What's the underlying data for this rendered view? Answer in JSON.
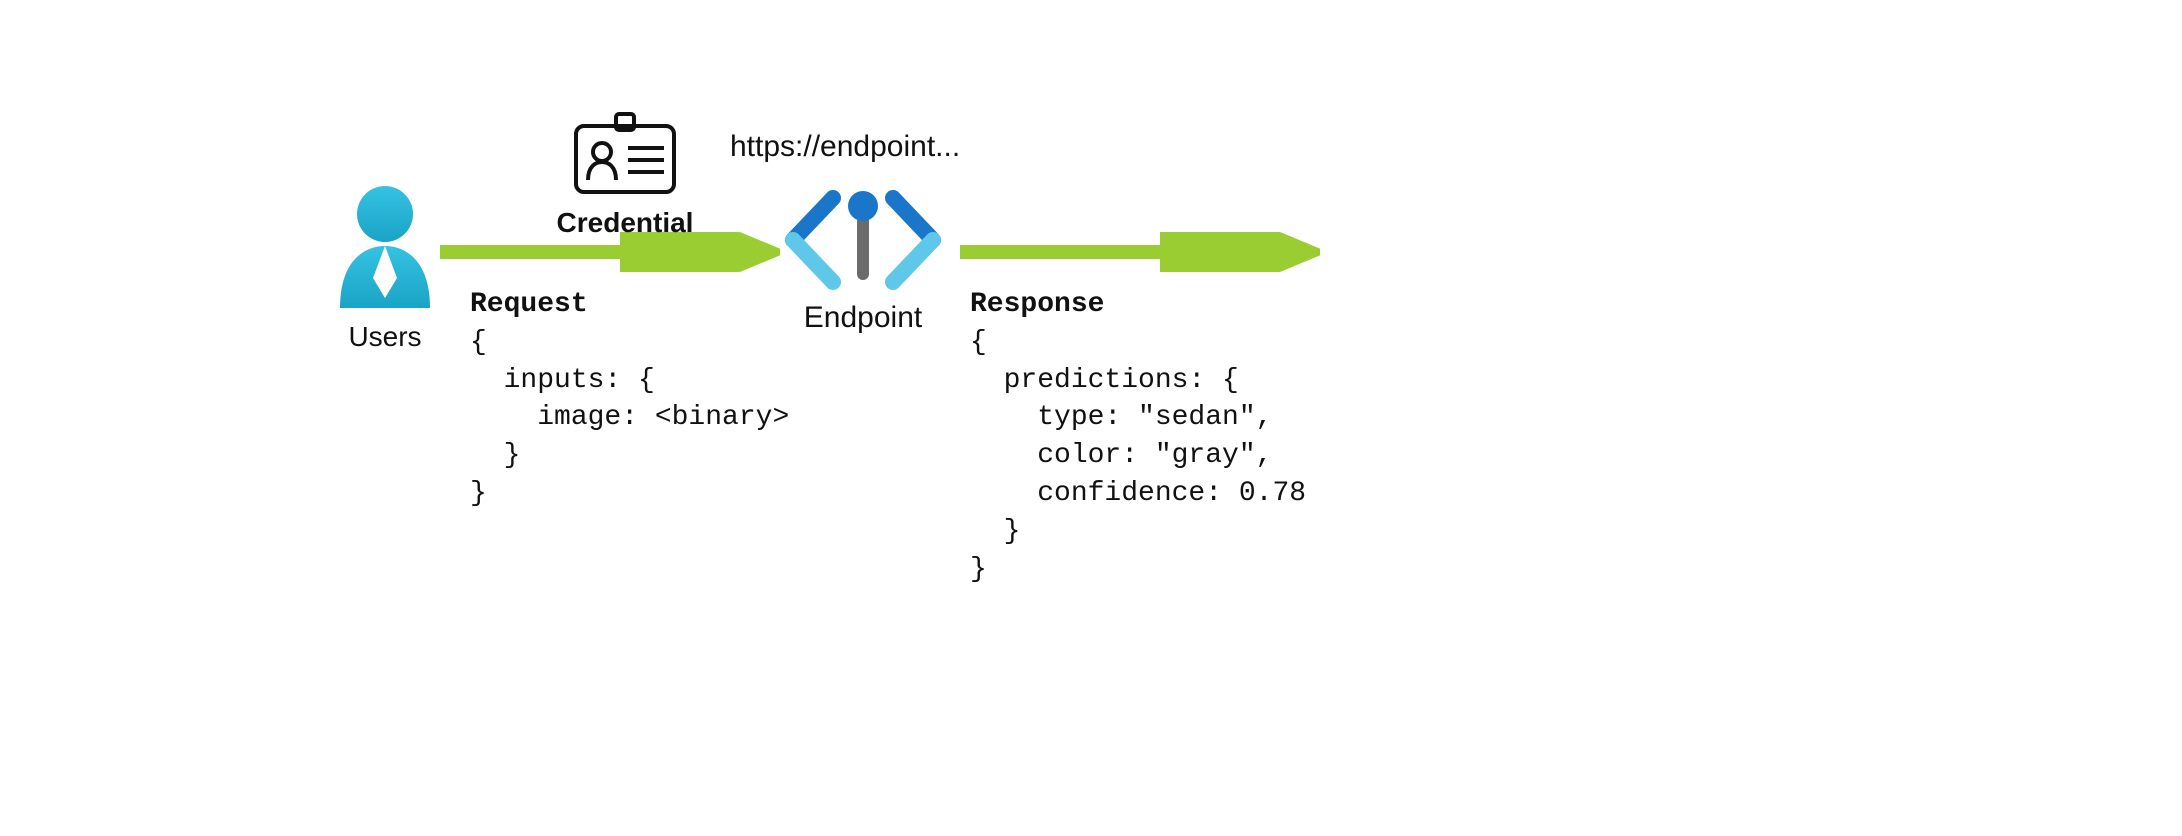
{
  "user": {
    "label": "Users"
  },
  "credential": {
    "label": "Credential"
  },
  "endpoint": {
    "url": "https://endpoint...",
    "label": "Endpoint"
  },
  "request": {
    "title": "Request",
    "body": "{\n  inputs: {\n    image: <binary>\n  }\n}"
  },
  "response": {
    "title": "Response",
    "body": "{\n  predictions: {\n    type: \"sedan\",\n    color: \"gray\",\n    confidence: 0.78\n  }\n}"
  },
  "colors": {
    "arrow": "#9ACD32",
    "user_fill": "#29B6D6",
    "endpoint_dark": "#1976C8",
    "endpoint_light": "#5FC8E8",
    "endpoint_stem": "#6b6b6b"
  }
}
